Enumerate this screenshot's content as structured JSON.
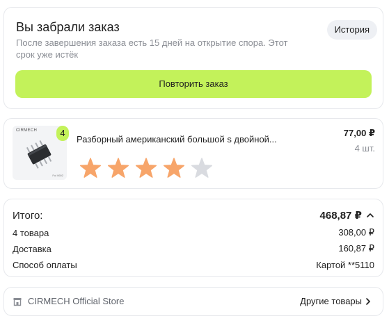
{
  "status": {
    "title": "Вы забрали заказ",
    "history_label": "История",
    "subtitle": "После завершения заказа есть 15 дней на открытие спора. Этот срок уже истёк",
    "repeat_label": "Повторить заказ"
  },
  "item": {
    "brand_logo": "CIRMECH",
    "thumb_caption": "Ful 0602",
    "quantity_badge": "4",
    "title": "Разборный американский большой s двойной...",
    "price": "77,00 ₽",
    "quantity": "4 шт.",
    "rating": 4,
    "rating_max": 5
  },
  "totals": {
    "total_label": "Итого:",
    "total_value": "468,87 ₽",
    "rows": [
      {
        "label": "4 товара",
        "value": "308,00 ₽"
      },
      {
        "label": "Доставка",
        "value": "160,87 ₽"
      },
      {
        "label": "Способ оплаты",
        "value": "Картой **5110"
      }
    ]
  },
  "store": {
    "name": "CIRMECH Official Store",
    "more_label": "Другие товары"
  },
  "colors": {
    "accent_green": "#c3f25a",
    "star_filled": "#f7a56a",
    "star_empty": "#d9dbe0",
    "muted_text": "#8a8d94"
  }
}
